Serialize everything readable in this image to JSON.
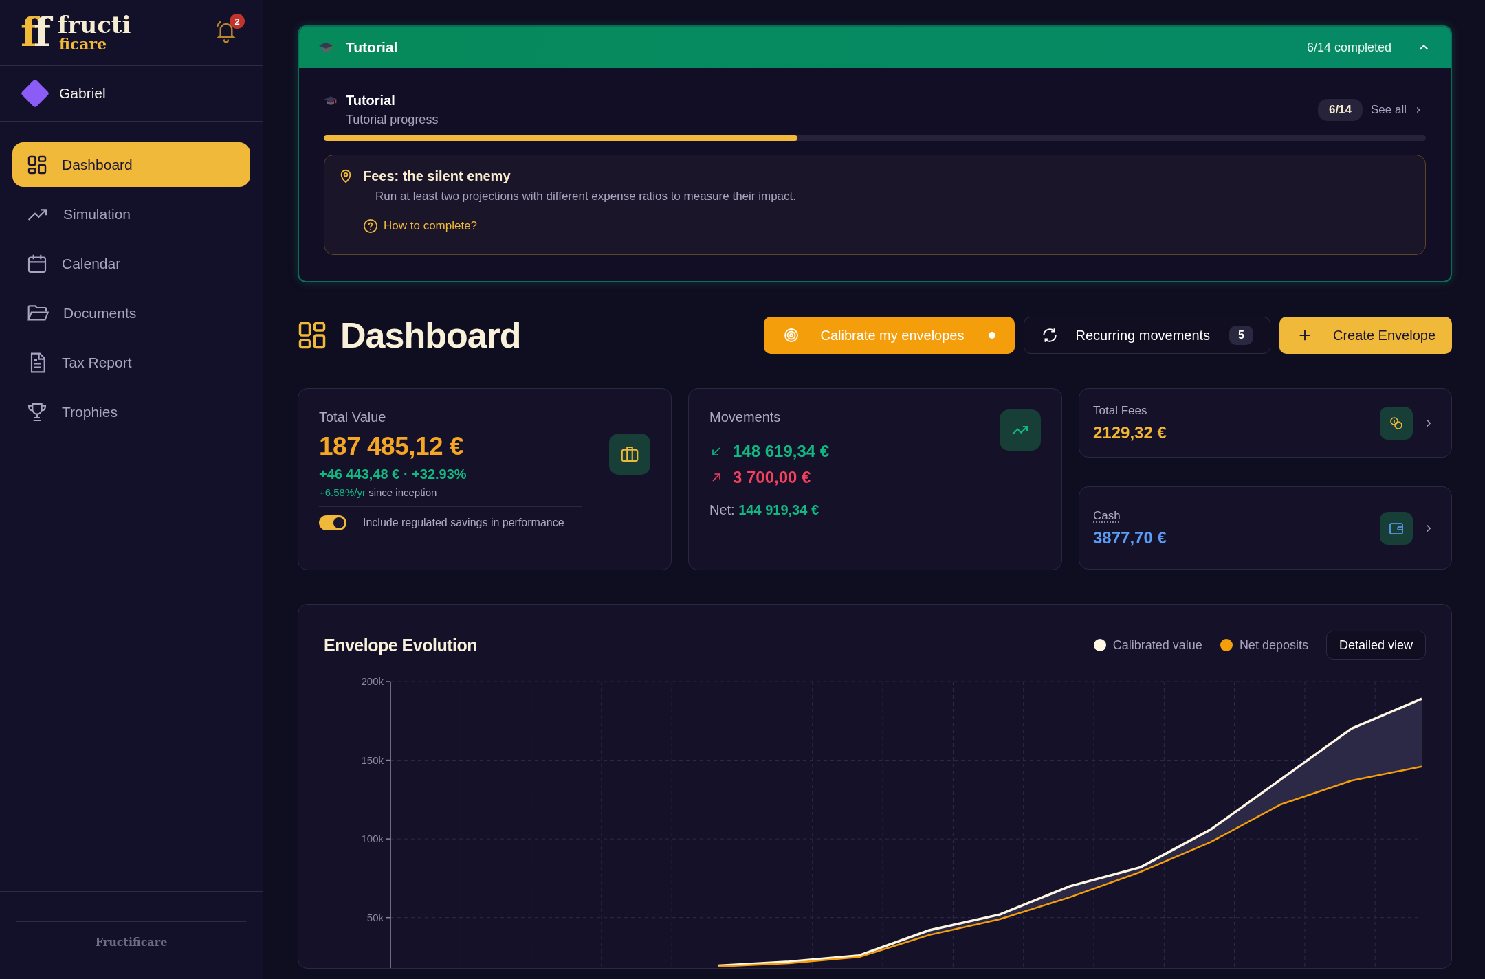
{
  "sidebar": {
    "logo": {
      "mark": [
        {
          "letter": "f",
          "color": "#f0b93a"
        },
        {
          "letter": "f",
          "color": "#f5ecd2"
        }
      ],
      "top": "fructi",
      "bottom": "ficare"
    },
    "notifications": {
      "count": "2"
    },
    "user": {
      "name": "Gabriel"
    },
    "nav": [
      {
        "label": "Dashboard",
        "selected": true
      },
      {
        "label": "Simulation",
        "selected": false
      },
      {
        "label": "Calendar",
        "selected": false
      },
      {
        "label": "Documents",
        "selected": false
      },
      {
        "label": "Tax Report",
        "selected": false
      },
      {
        "label": "Trophies",
        "selected": false
      }
    ],
    "footer": "Fructificare"
  },
  "tutorial": {
    "title": "Tutorial",
    "status": "6/14 completed",
    "expanded": true,
    "heading": "Tutorial",
    "subtitle": "Tutorial progress",
    "badge": "6/14",
    "see_all": "See all",
    "level": 0.43,
    "task": {
      "title": "Fees: the silent enemy",
      "description": "Run at least two projections with different expense ratios to measure their impact.",
      "help": "How to complete?"
    }
  },
  "page": {
    "title": "Dashboard",
    "actions": [
      {
        "kind": "calibrate",
        "label": "Calibrate my envelopes",
        "dot": true
      },
      {
        "kind": "recurring",
        "label": "Recurring movements",
        "count": "5"
      },
      {
        "kind": "create",
        "label": "Create Envelope"
      }
    ]
  },
  "total_value": {
    "label": "Total Value",
    "value": "187 485,12 €",
    "gain": "+46 443,48 € · +32.93%",
    "rate": "+6.58%/yr",
    "rate_note": "since inception",
    "toggle": {
      "label": "Include regulated savings in performance",
      "on": true
    }
  },
  "movements": {
    "label": "Movements",
    "inflow": "148 619,34 €",
    "outflow": "3 700,00 €",
    "net_label": "Net:",
    "net": "144 919,34 €"
  },
  "fees": {
    "label": "Total Fees",
    "value": "2129,32 €"
  },
  "cash": {
    "label": "Cash",
    "value": "3877,70 €"
  },
  "chart": {
    "title": "Envelope Evolution",
    "button": "Detailed view",
    "chart_data": {
      "type": "line",
      "grid": true,
      "ylim": [
        18000,
        200000
      ],
      "yticks": [
        {
          "value": 50000,
          "label": "50k"
        },
        {
          "value": 100000,
          "label": "100k"
        },
        {
          "value": 150000,
          "label": "150k"
        },
        {
          "value": 200000,
          "label": "200k"
        }
      ],
      "series": [
        {
          "name": "Calibrated value",
          "type": "area",
          "color": "#fdf6e3",
          "values": [
            19500,
            22000,
            26000,
            42000,
            52000,
            70000,
            82000,
            106000,
            138000,
            170000,
            189000
          ]
        },
        {
          "name": "Net deposits",
          "type": "line",
          "color": "#f59e0b",
          "values": [
            19000,
            21000,
            25000,
            39000,
            49000,
            63000,
            79000,
            98000,
            122000,
            137000,
            146000
          ]
        }
      ]
    }
  }
}
